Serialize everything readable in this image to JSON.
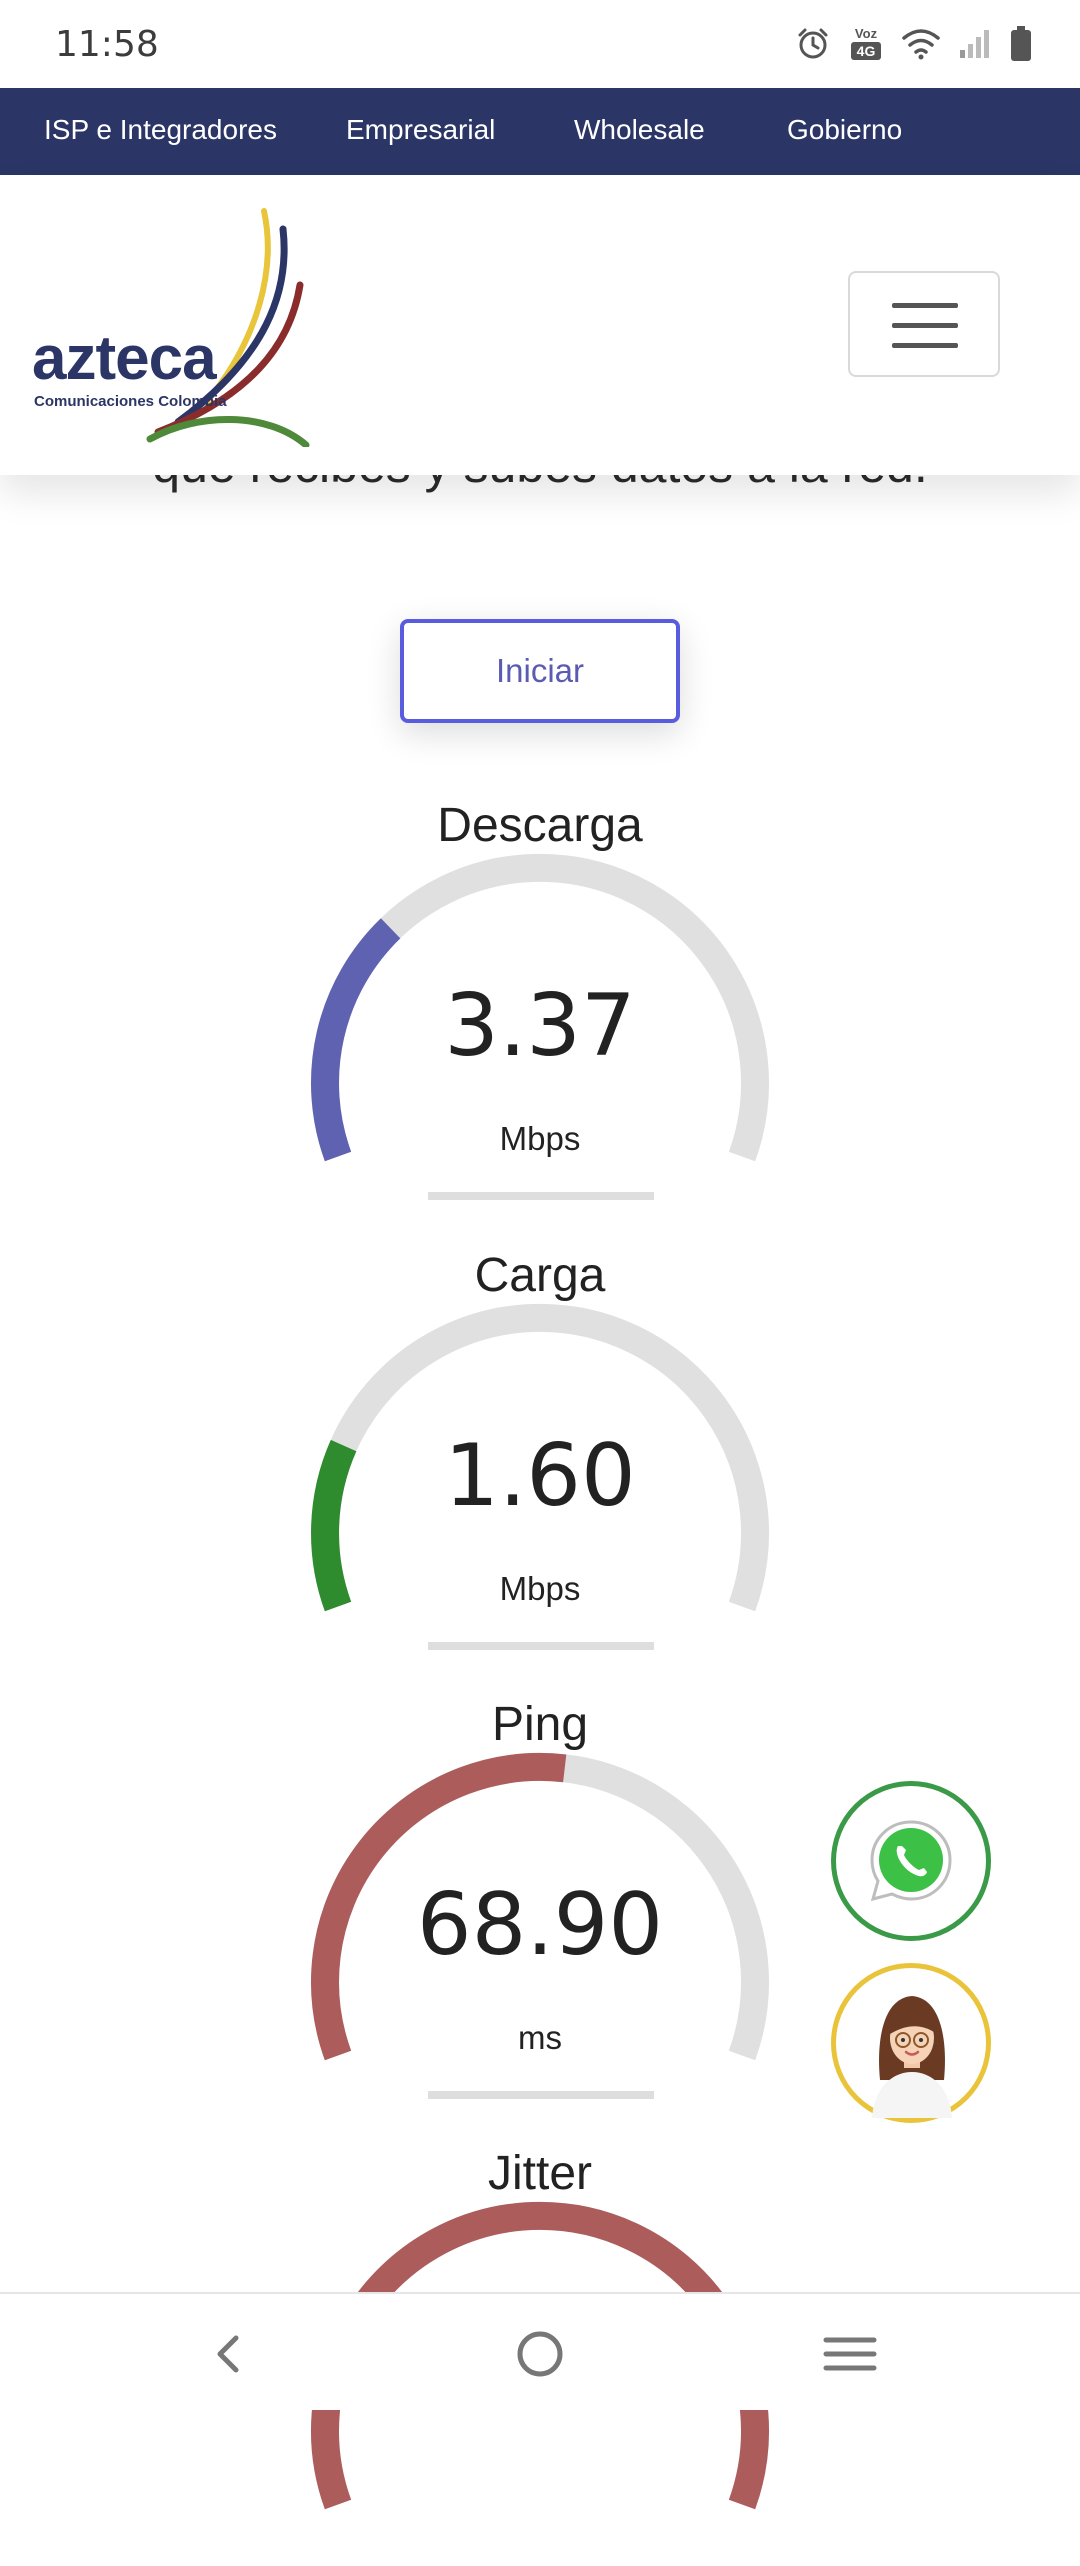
{
  "status_bar": {
    "time": "11:58",
    "volte_label": "Voz",
    "network_label": "4G"
  },
  "top_nav": {
    "items": [
      "ISP e Integradores",
      "Empresarial",
      "Wholesale",
      "Gobierno"
    ]
  },
  "logo": {
    "name": "azteca",
    "subtitle": "Comunicaciones Colombia"
  },
  "intro_text": "que recibes y subes datos a la red.",
  "start_button": {
    "label": "Iniciar"
  },
  "gauges": [
    {
      "title": "Descarga",
      "value": "3.37",
      "unit": "Mbps",
      "fraction": 0.3,
      "color": "#5e62b0"
    },
    {
      "title": "Carga",
      "value": "1.60",
      "unit": "Mbps",
      "fraction": 0.2,
      "color": "#2e8b2e"
    },
    {
      "title": "Ping",
      "value": "68.90",
      "unit": "ms",
      "fraction": 0.53,
      "color": "#ad5c5c"
    },
    {
      "title": "Jitter",
      "value": "",
      "unit": "",
      "fraction": 1.0,
      "color": "#ad5c5c"
    }
  ],
  "colors": {
    "nav_bg": "#2b3566",
    "accent_button": "#5a5ce0",
    "track": "#e0e0e0",
    "whatsapp": "#3a9a48",
    "assistant_ring": "#e9c43a"
  },
  "floating_buttons": {
    "whatsapp_icon": "whatsapp-icon",
    "assistant_icon": "assistant-avatar-icon"
  },
  "bottom_nav": {
    "icons": [
      "back-icon",
      "home-icon",
      "recents-icon"
    ]
  }
}
